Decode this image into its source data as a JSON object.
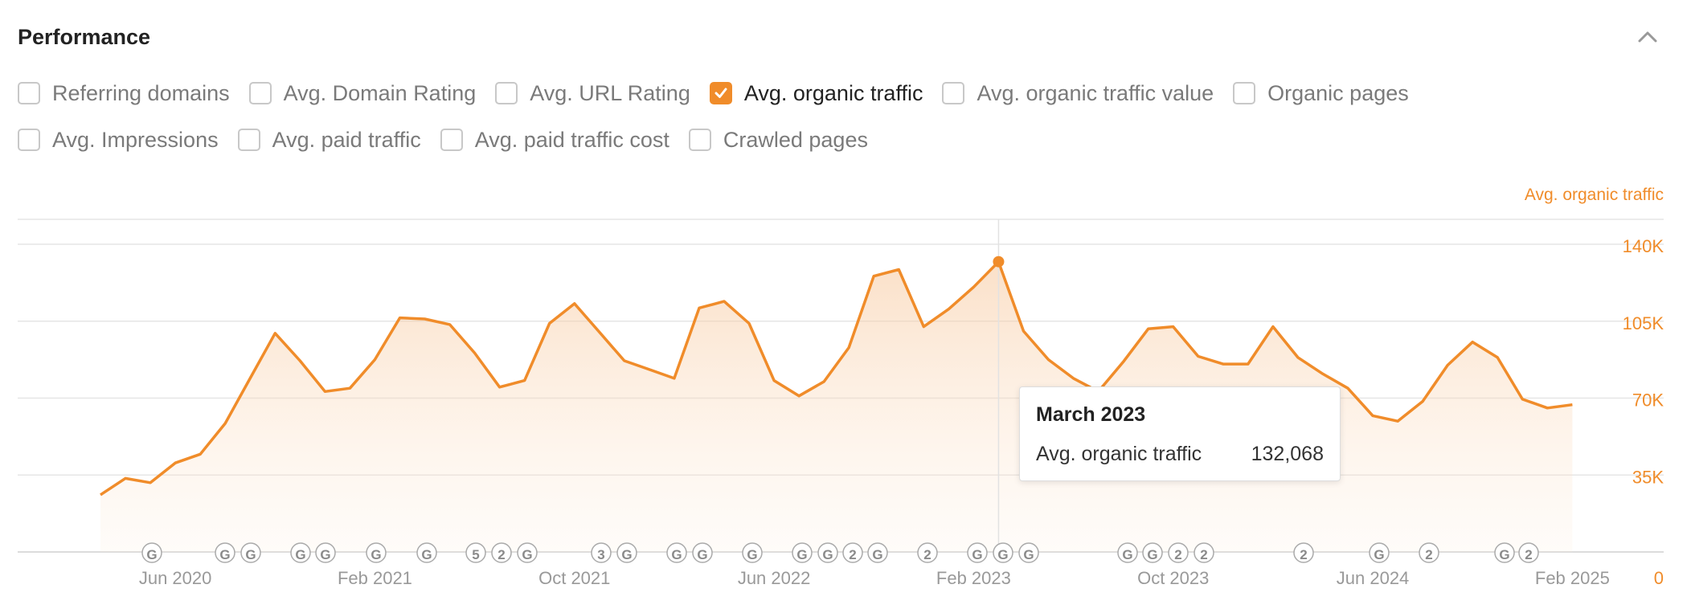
{
  "header": {
    "title": "Performance"
  },
  "options": {
    "row1": [
      {
        "label": "Referring domains",
        "checked": false
      },
      {
        "label": "Avg. Domain Rating",
        "checked": false
      },
      {
        "label": "Avg. URL Rating",
        "checked": false
      },
      {
        "label": "Avg. organic traffic",
        "checked": true
      },
      {
        "label": "Avg. organic traffic value",
        "checked": false
      },
      {
        "label": "Organic pages",
        "checked": false
      }
    ],
    "row2": [
      {
        "label": "Avg. Impressions",
        "checked": false
      },
      {
        "label": "Avg. paid traffic",
        "checked": false
      },
      {
        "label": "Avg. paid traffic cost",
        "checked": false
      },
      {
        "label": "Crawled pages",
        "checked": false
      }
    ]
  },
  "tooltip": {
    "title": "March 2023",
    "metric": "Avg. organic traffic",
    "value": "132,068"
  },
  "chart_data": {
    "type": "area",
    "series_label": "Avg. organic traffic",
    "y_ticks": [
      "0",
      "35K",
      "70K",
      "105K",
      "140K"
    ],
    "ylim": [
      0,
      140000
    ],
    "x_ticks": [
      "Jun 2020",
      "Feb 2021",
      "Oct 2021",
      "Jun 2022",
      "Feb 2023",
      "Oct 2023",
      "Jun 2024",
      "Feb 2025"
    ],
    "x_tick_months": [
      5,
      13,
      21,
      29,
      37,
      45,
      53,
      61
    ],
    "series": [
      {
        "name": "Avg. organic traffic",
        "color": "#f08c2a",
        "start": "Mar 2020",
        "values": [
          26000,
          33500,
          31500,
          40500,
          44500,
          58500,
          79000,
          99500,
          87000,
          73000,
          74500,
          87500,
          106500,
          106000,
          103500,
          90500,
          75000,
          78000,
          104000,
          113000,
          100000,
          87000,
          83000,
          79000,
          111000,
          114000,
          104000,
          78000,
          71000,
          77500,
          93000,
          125500,
          128500,
          102500,
          110500,
          120500,
          132000,
          100500,
          87500,
          79000,
          73000,
          86500,
          101500,
          102500,
          89000,
          85500,
          85500,
          102500,
          88500,
          81000,
          74500,
          62000,
          59500,
          68500,
          85000,
          95500,
          88500,
          69500,
          65500,
          67000
        ]
      }
    ],
    "highlight": {
      "month": "Mar 2023",
      "value": 132068
    },
    "event_markers": [
      {
        "x": 189,
        "label": "G"
      },
      {
        "x": 280,
        "label": "G"
      },
      {
        "x": 312,
        "label": "G"
      },
      {
        "x": 374,
        "label": "G"
      },
      {
        "x": 405,
        "label": "G"
      },
      {
        "x": 468,
        "label": "G"
      },
      {
        "x": 531,
        "label": "G"
      },
      {
        "x": 592,
        "label": "5"
      },
      {
        "x": 624,
        "label": "2"
      },
      {
        "x": 656,
        "label": "G"
      },
      {
        "x": 748,
        "label": "3"
      },
      {
        "x": 780,
        "label": "G"
      },
      {
        "x": 842,
        "label": "G"
      },
      {
        "x": 874,
        "label": "G"
      },
      {
        "x": 936,
        "label": "G"
      },
      {
        "x": 998,
        "label": "G"
      },
      {
        "x": 1030,
        "label": "G"
      },
      {
        "x": 1061,
        "label": "2"
      },
      {
        "x": 1092,
        "label": "G"
      },
      {
        "x": 1154,
        "label": "2"
      },
      {
        "x": 1216,
        "label": "G"
      },
      {
        "x": 1248,
        "label": "G"
      },
      {
        "x": 1280,
        "label": "G"
      },
      {
        "x": 1403,
        "label": "G"
      },
      {
        "x": 1434,
        "label": "G"
      },
      {
        "x": 1466,
        "label": "2"
      },
      {
        "x": 1498,
        "label": "2"
      },
      {
        "x": 1622,
        "label": "2"
      },
      {
        "x": 1716,
        "label": "G"
      },
      {
        "x": 1778,
        "label": "2"
      },
      {
        "x": 1872,
        "label": "G"
      },
      {
        "x": 1902,
        "label": "2"
      }
    ]
  },
  "colors": {
    "accent": "#f08c2a",
    "grid": "#e6e6e6",
    "axis_text": "#999999"
  }
}
